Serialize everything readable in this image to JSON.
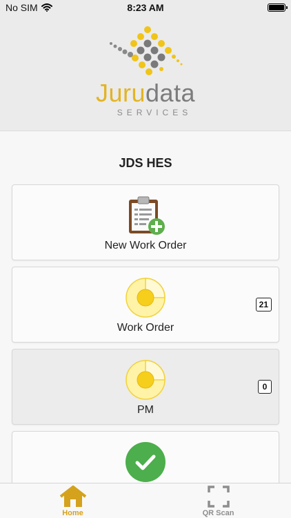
{
  "status": {
    "carrier": "No SIM",
    "time": "8:23 AM"
  },
  "header": {
    "logo_part1": "Juru",
    "logo_part2": "data",
    "logo_sub": "SERVICES"
  },
  "page_title": "JDS HES",
  "cards": [
    {
      "label": "New Work Order",
      "icon": "clipboard-add-icon"
    },
    {
      "label": "Work Order",
      "icon": "dial-icon",
      "badge": "21"
    },
    {
      "label": "PM",
      "icon": "dial-icon",
      "badge": "0"
    },
    {
      "label": "",
      "icon": "checkmark-icon"
    }
  ],
  "tabs": [
    {
      "label": "Home",
      "icon": "home-icon",
      "active": true
    },
    {
      "label": "QR Scan",
      "icon": "qr-scan-icon",
      "active": false
    }
  ],
  "colors": {
    "accent": "#d4a21c",
    "inactive": "#8e8e8e",
    "green": "#4cae4c",
    "yellow": "#ffe56b"
  }
}
